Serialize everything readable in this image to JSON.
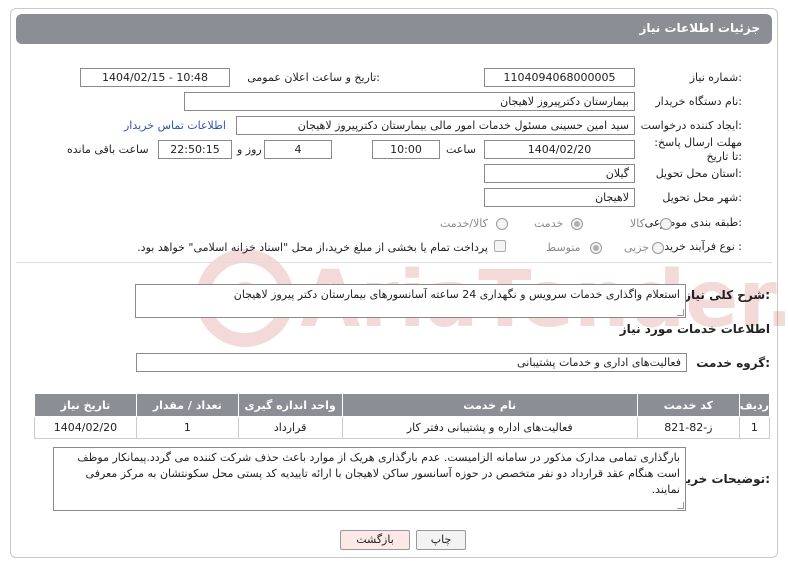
{
  "header": {
    "title": "جزئیات اطلاعات نیاز"
  },
  "fields": {
    "need_number_label": "شماره نیاز:",
    "need_number": "1104094068000005",
    "announce_label": "تاریخ و ساعت اعلان عمومی:",
    "announce_value": "1404/02/15 - 10:48",
    "buyer_org_label": "نام دستگاه خریدار:",
    "buyer_org": "بیمارستان دکترپیروز لاهیجان",
    "creator_label": "ایجاد کننده درخواست:",
    "creator": "سید امین حسینی مسئول خدمات امور مالی بیمارستان دکترپیروز لاهیجان",
    "contact_link": "اطلاعات تماس خریدار",
    "deadline_label": "مهلت ارسال پاسخ: تا تاریخ:",
    "deadline_date": "1404/02/20",
    "time_label": "ساعت",
    "deadline_time": "10:00",
    "days_value": "4",
    "days_label": "روز و",
    "remaining_time": "22:50:15",
    "remaining_label": "ساعت باقی مانده",
    "province_label": "استان محل تحویل:",
    "province": "گیلان",
    "city_label": "شهر محل تحویل:",
    "city": "لاهیجان",
    "category_label": "طبقه بندی موضوعی:",
    "category_options": [
      "کالا",
      "خدمت",
      "کالا/خدمت"
    ],
    "category_selected": "خدمت",
    "process_label": "نوع فرآیند خرید :",
    "process_options": [
      "جزیی",
      "متوسط"
    ],
    "process_selected": "متوسط",
    "payment_note": "پرداخت تمام یا بخشی از مبلغ خرید،از محل \"اسناد خزانه اسلامی\" خواهد بود."
  },
  "description": {
    "label": "شرح کلی نیاز:",
    "text": "استعلام واگذاری خدمات سرویس و نگهداری 24 ساعته آسانسورهای بیمارستان دکتر پیروز لاهیجان"
  },
  "services_info": {
    "title": "اطلاعات خدمات مورد نیاز",
    "group_label": "گروه خدمت:",
    "group_value": "فعالیت‌های اداری و خدمات پشتیبانی"
  },
  "table": {
    "headers": [
      "ردیف",
      "کد خدمت",
      "نام خدمت",
      "واحد اندازه گیری",
      "تعداد / مقدار",
      "تاریخ نیاز"
    ],
    "rows": [
      [
        "1",
        "ز-82-821",
        "فعالیت‌های اداره و پشتیبانی دفتر کار",
        "قرارداد",
        "1",
        "1404/02/20"
      ]
    ]
  },
  "buyer_notes": {
    "label": "توضیحات خریدار:",
    "text": "بارگذاری تمامی مدارک مذکور در سامانه الزامیست. عدم بارگذاری هریک از موارد باعث حذف شرکت کننده می گردد.پیمانکار موظف است هنگام عقد قرارداد دو نفر متخصص در حوزه آسانسور ساکن لاهیجان با ارائه تاییدیه کد پستی محل سکونتشان به مرکز معرفی نمایند."
  },
  "buttons": {
    "print": "چاپ",
    "back": "بازگشت"
  },
  "watermark": {
    "text": "AriaTender.neT"
  },
  "colors": {
    "header_bg": "#8b8e94",
    "link": "#2a56b8",
    "back_bg": "#fde8e8",
    "watermark": "#c0392b"
  }
}
